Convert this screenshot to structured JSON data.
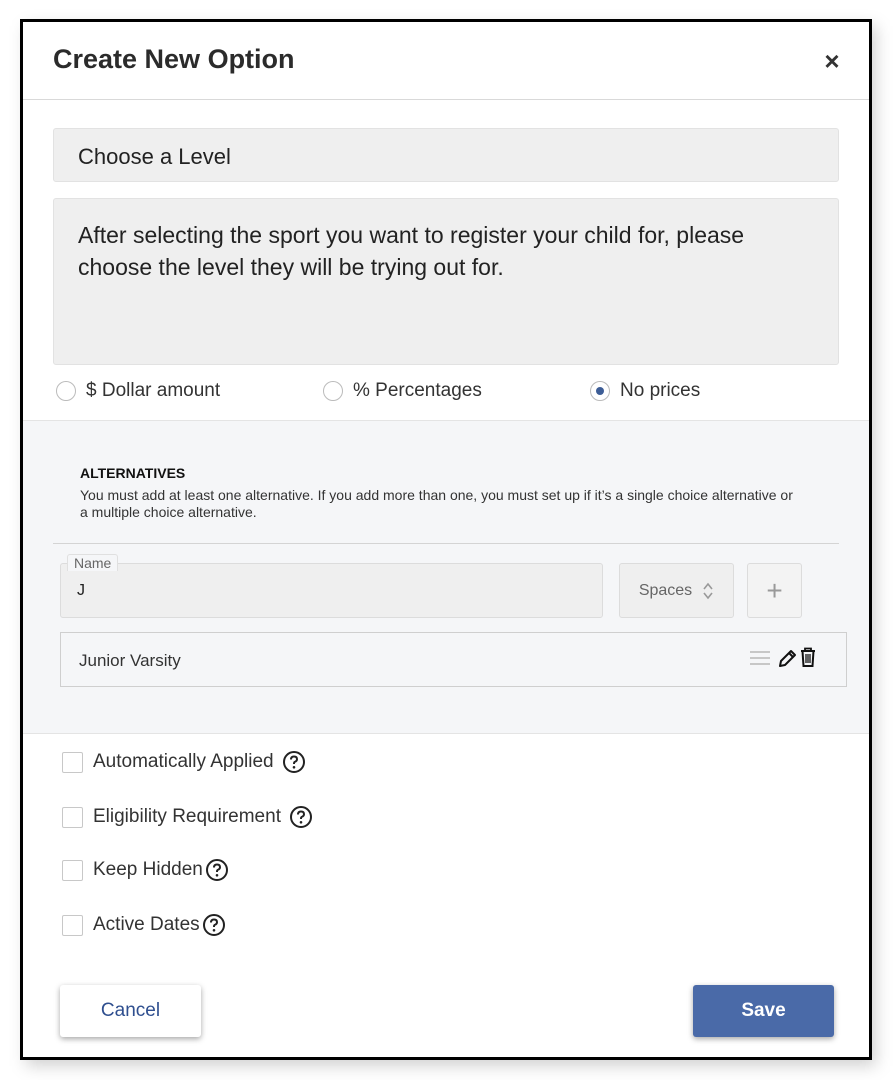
{
  "modal": {
    "title": "Create New Option",
    "close_icon": "×"
  },
  "option": {
    "title_value": "Choose a Level",
    "description_value": "After selecting the sport you want to register your child for, please choose the level they will be trying out for."
  },
  "pricing": {
    "options": [
      {
        "label": "$ Dollar amount",
        "selected": false
      },
      {
        "label": "% Percentages",
        "selected": false
      },
      {
        "label": "No prices",
        "selected": true
      }
    ]
  },
  "alternatives": {
    "heading": "ALTERNATIVES",
    "help": "You must add at least one alternative. If you add more than one, you must set up if it’s a single choice alternative or a multiple choice alternative.",
    "name_label": "Name",
    "name_value": "J",
    "spaces_label": "Spaces",
    "add_icon": "+",
    "items": [
      {
        "label": "Junior Varsity"
      }
    ]
  },
  "settings": [
    {
      "label": "Automatically Applied",
      "checked": false
    },
    {
      "label": "Eligibility Requirement",
      "checked": false
    },
    {
      "label": "Keep Hidden",
      "checked": false
    },
    {
      "label": "Active Dates",
      "checked": false
    }
  ],
  "footer": {
    "cancel_label": "Cancel",
    "save_label": "Save"
  },
  "colors": {
    "primary": "#4a6aa8",
    "link": "#2f4f8f",
    "radio_selected": "#3d5d96"
  }
}
